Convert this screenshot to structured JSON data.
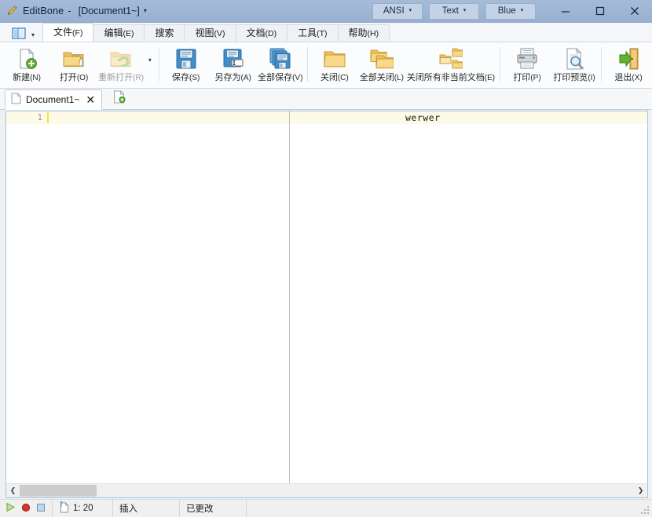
{
  "titlebar": {
    "app_name": "EditBone",
    "separator": "-",
    "document": "[Document1~]",
    "caret": "▾",
    "app_icon": "pencil-icon",
    "encoding": {
      "label": "ANSI",
      "caret": "▾"
    },
    "filetype": {
      "label": "Text",
      "caret": "▾"
    },
    "theme": {
      "label": "Blue",
      "caret": "▾"
    },
    "minimize": "minimize-icon",
    "maximize": "maximize-icon",
    "close": "close-icon"
  },
  "menubar": {
    "quick_access_icon": "panel-layout-icon",
    "quick_access_caret": "▾",
    "tabs": [
      {
        "label": "文件",
        "mnemonic": "(F)",
        "active": true
      },
      {
        "label": "编辑",
        "mnemonic": "(E)",
        "active": false
      },
      {
        "label": "搜索",
        "mnemonic": "",
        "active": false
      },
      {
        "label": "视图",
        "mnemonic": "(V)",
        "active": false
      },
      {
        "label": "文档",
        "mnemonic": "(D)",
        "active": false
      },
      {
        "label": "工具",
        "mnemonic": "(T)",
        "active": false
      },
      {
        "label": "帮助",
        "mnemonic": "(H)",
        "active": false
      }
    ]
  },
  "ribbon": {
    "buttons": [
      {
        "name": "new",
        "label": "新建",
        "mnemonic": "(N)",
        "icon": "new-document-icon",
        "disabled": false
      },
      {
        "name": "open",
        "label": "打开",
        "mnemonic": "(O)",
        "icon": "open-folder-icon",
        "disabled": false
      },
      {
        "name": "reopen",
        "label": "重新打开",
        "mnemonic": "(R)",
        "icon": "reopen-folder-icon",
        "disabled": true
      },
      {
        "name": "save",
        "label": "保存",
        "mnemonic": "(S)",
        "icon": "floppy-save-icon",
        "disabled": false
      },
      {
        "name": "save-as",
        "label": "另存为",
        "mnemonic": "(A)",
        "icon": "floppy-save-as-icon",
        "disabled": false
      },
      {
        "name": "save-all",
        "label": "全部保存",
        "mnemonic": "(V)",
        "icon": "floppy-save-all-icon",
        "disabled": false
      },
      {
        "name": "close",
        "label": "关闭",
        "mnemonic": "(C)",
        "icon": "folder-close-icon",
        "disabled": false
      },
      {
        "name": "close-all",
        "label": "全部关闭",
        "mnemonic": "(L)",
        "icon": "folders-close-all-icon",
        "disabled": false
      },
      {
        "name": "close-others",
        "label": "关闭所有非当前文档",
        "mnemonic": "(E)",
        "icon": "folders-close-others-icon",
        "disabled": false
      },
      {
        "name": "print",
        "label": "打印",
        "mnemonic": "(P)",
        "icon": "printer-icon",
        "disabled": false
      },
      {
        "name": "print-preview",
        "label": "打印预览",
        "mnemonic": "(I)",
        "icon": "print-preview-icon",
        "disabled": false
      },
      {
        "name": "exit",
        "label": "退出",
        "mnemonic": "(X)",
        "icon": "exit-door-icon",
        "disabled": false
      }
    ],
    "reopen_dropdown_caret": "▾"
  },
  "doctabs": {
    "tabs": [
      {
        "label": "Document1~",
        "icon": "document-icon",
        "close": "✕",
        "active": true
      }
    ],
    "new_tab_icon": "new-document-plus-icon"
  },
  "editor": {
    "line_numbers": [
      "1"
    ],
    "lines": [
      "werwer"
    ],
    "hscroll": {
      "left_arrow": "❮",
      "right_arrow": "❯"
    }
  },
  "statusbar": {
    "macro_play_icon": "play-icon",
    "macro_record_icon": "record-icon",
    "macro_stop_icon": "stop-icon",
    "position_icon": "caret-position-icon",
    "position": "1: 20",
    "insert_mode": "插入",
    "modified": "已更改",
    "extra": ""
  },
  "colors": {
    "titlebar_start": "#a5bbd8",
    "titlebar_end": "#98b0d1",
    "editor_border": "#9ec7e8",
    "active_line": "#fdfbe8",
    "caret": "#f2e53c",
    "folder": "#f5c86a",
    "floppy": "#3b87c8",
    "accent_green": "#5aa832",
    "record_red": "#d42b21"
  }
}
